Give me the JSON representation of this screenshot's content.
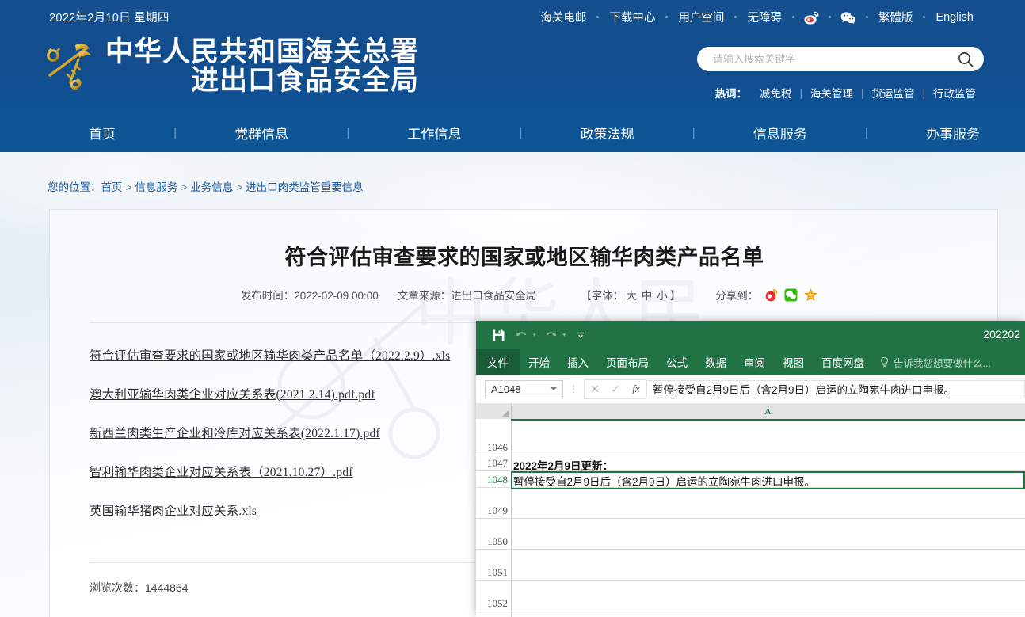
{
  "header": {
    "date": "2022年2月10日 星期四",
    "top_links": [
      "海关电邮",
      "下载中心",
      "用户空间",
      "无障碍"
    ],
    "weibo_icon": "weibo-icon",
    "wechat_icon": "wechat-icon",
    "lang_links": [
      "繁體版",
      "English"
    ],
    "logo_line1": "中华人民共和国海关总署",
    "logo_line2": "进出口食品安全局",
    "logo_icon": "customs-emblem-icon",
    "search": {
      "placeholder": "请输入搜索关键字",
      "value": "",
      "icon": "search-icon"
    },
    "hot_label": "热词：",
    "hot_words": [
      "减免税",
      "海关管理",
      "货运监管",
      "行政监管"
    ]
  },
  "nav": {
    "items": [
      "首页",
      "党群信息",
      "工作信息",
      "政策法规",
      "信息服务",
      "办事服务"
    ],
    "divider": "|"
  },
  "breadcrumb": {
    "prefix": "您的位置：",
    "items": [
      "首页",
      "信息服务",
      "业务信息",
      "进出口肉类监管重要信息"
    ],
    "sep": ">"
  },
  "article": {
    "title": "符合评估审查要求的国家或地区输华肉类产品名单",
    "publish_label": "发布时间：",
    "publish_time": "2022-02-09 00:00",
    "source_label": "文章来源：",
    "source": "进出口食品安全局",
    "font_label_open": "【字体：",
    "font_sizes": [
      "大",
      "中",
      "小"
    ],
    "font_label_close": "】",
    "share_label": "分享到：",
    "share_icons": [
      "weibo-share-icon",
      "wechat-share-icon",
      "favorite-star-icon"
    ],
    "files": [
      "符合评估审查要求的国家或地区输华肉类产品名单（2022.2.9）.xls",
      "澳大利亚输华肉类企业对应关系表(2021.2.14).pdf.pdf",
      "新西兰肉类生产企业和冷库对应关系表(2022.1.17).pdf",
      "智利输华肉类企业对应关系表（2021.10.27）.pdf",
      "英国输华猪肉企业对应关系.xls"
    ],
    "views_label": "浏览次数：",
    "views_count": "1444864"
  },
  "excel": {
    "save_icon": "save-icon",
    "undo_icon": "undo-icon",
    "redo_icon": "redo-icon",
    "customize_icon": "customize-qat-icon",
    "doc_name": "202202",
    "file_tab": "文件",
    "ribbon_tabs": [
      "开始",
      "插入",
      "页面布局",
      "公式",
      "数据",
      "审阅",
      "视图",
      "百度网盘"
    ],
    "tellme_icon": "lightbulb-icon",
    "tellme_text": "告诉我您想要做什么...",
    "name_box": "A1048",
    "cancel_icon": "cancel-icon",
    "confirm_icon": "confirm-icon",
    "fx_icon": "fx-icon",
    "formula_value": "暂停接受自2月9日后（含2月9日）启运的立陶宛牛肉进口申报。",
    "column_header": "A",
    "rows": [
      {
        "num": "1046",
        "value": ""
      },
      {
        "num": "1047",
        "value": "2022年2月9日更新："
      },
      {
        "num": "1048",
        "value": "暂停接受自2月9日后（含2月9日）启运的立陶宛牛肉进口申报。"
      },
      {
        "num": "1049",
        "value": ""
      },
      {
        "num": "1050",
        "value": ""
      },
      {
        "num": "1051",
        "value": ""
      },
      {
        "num": "1052",
        "value": ""
      }
    ],
    "selected_row": "1048"
  },
  "colors": {
    "header_blue": "#14508f",
    "nav_blue": "#0d5594",
    "excel_green": "#217346",
    "excel_file_green": "#1a5c38",
    "link_blue": "#1b5a9e"
  }
}
